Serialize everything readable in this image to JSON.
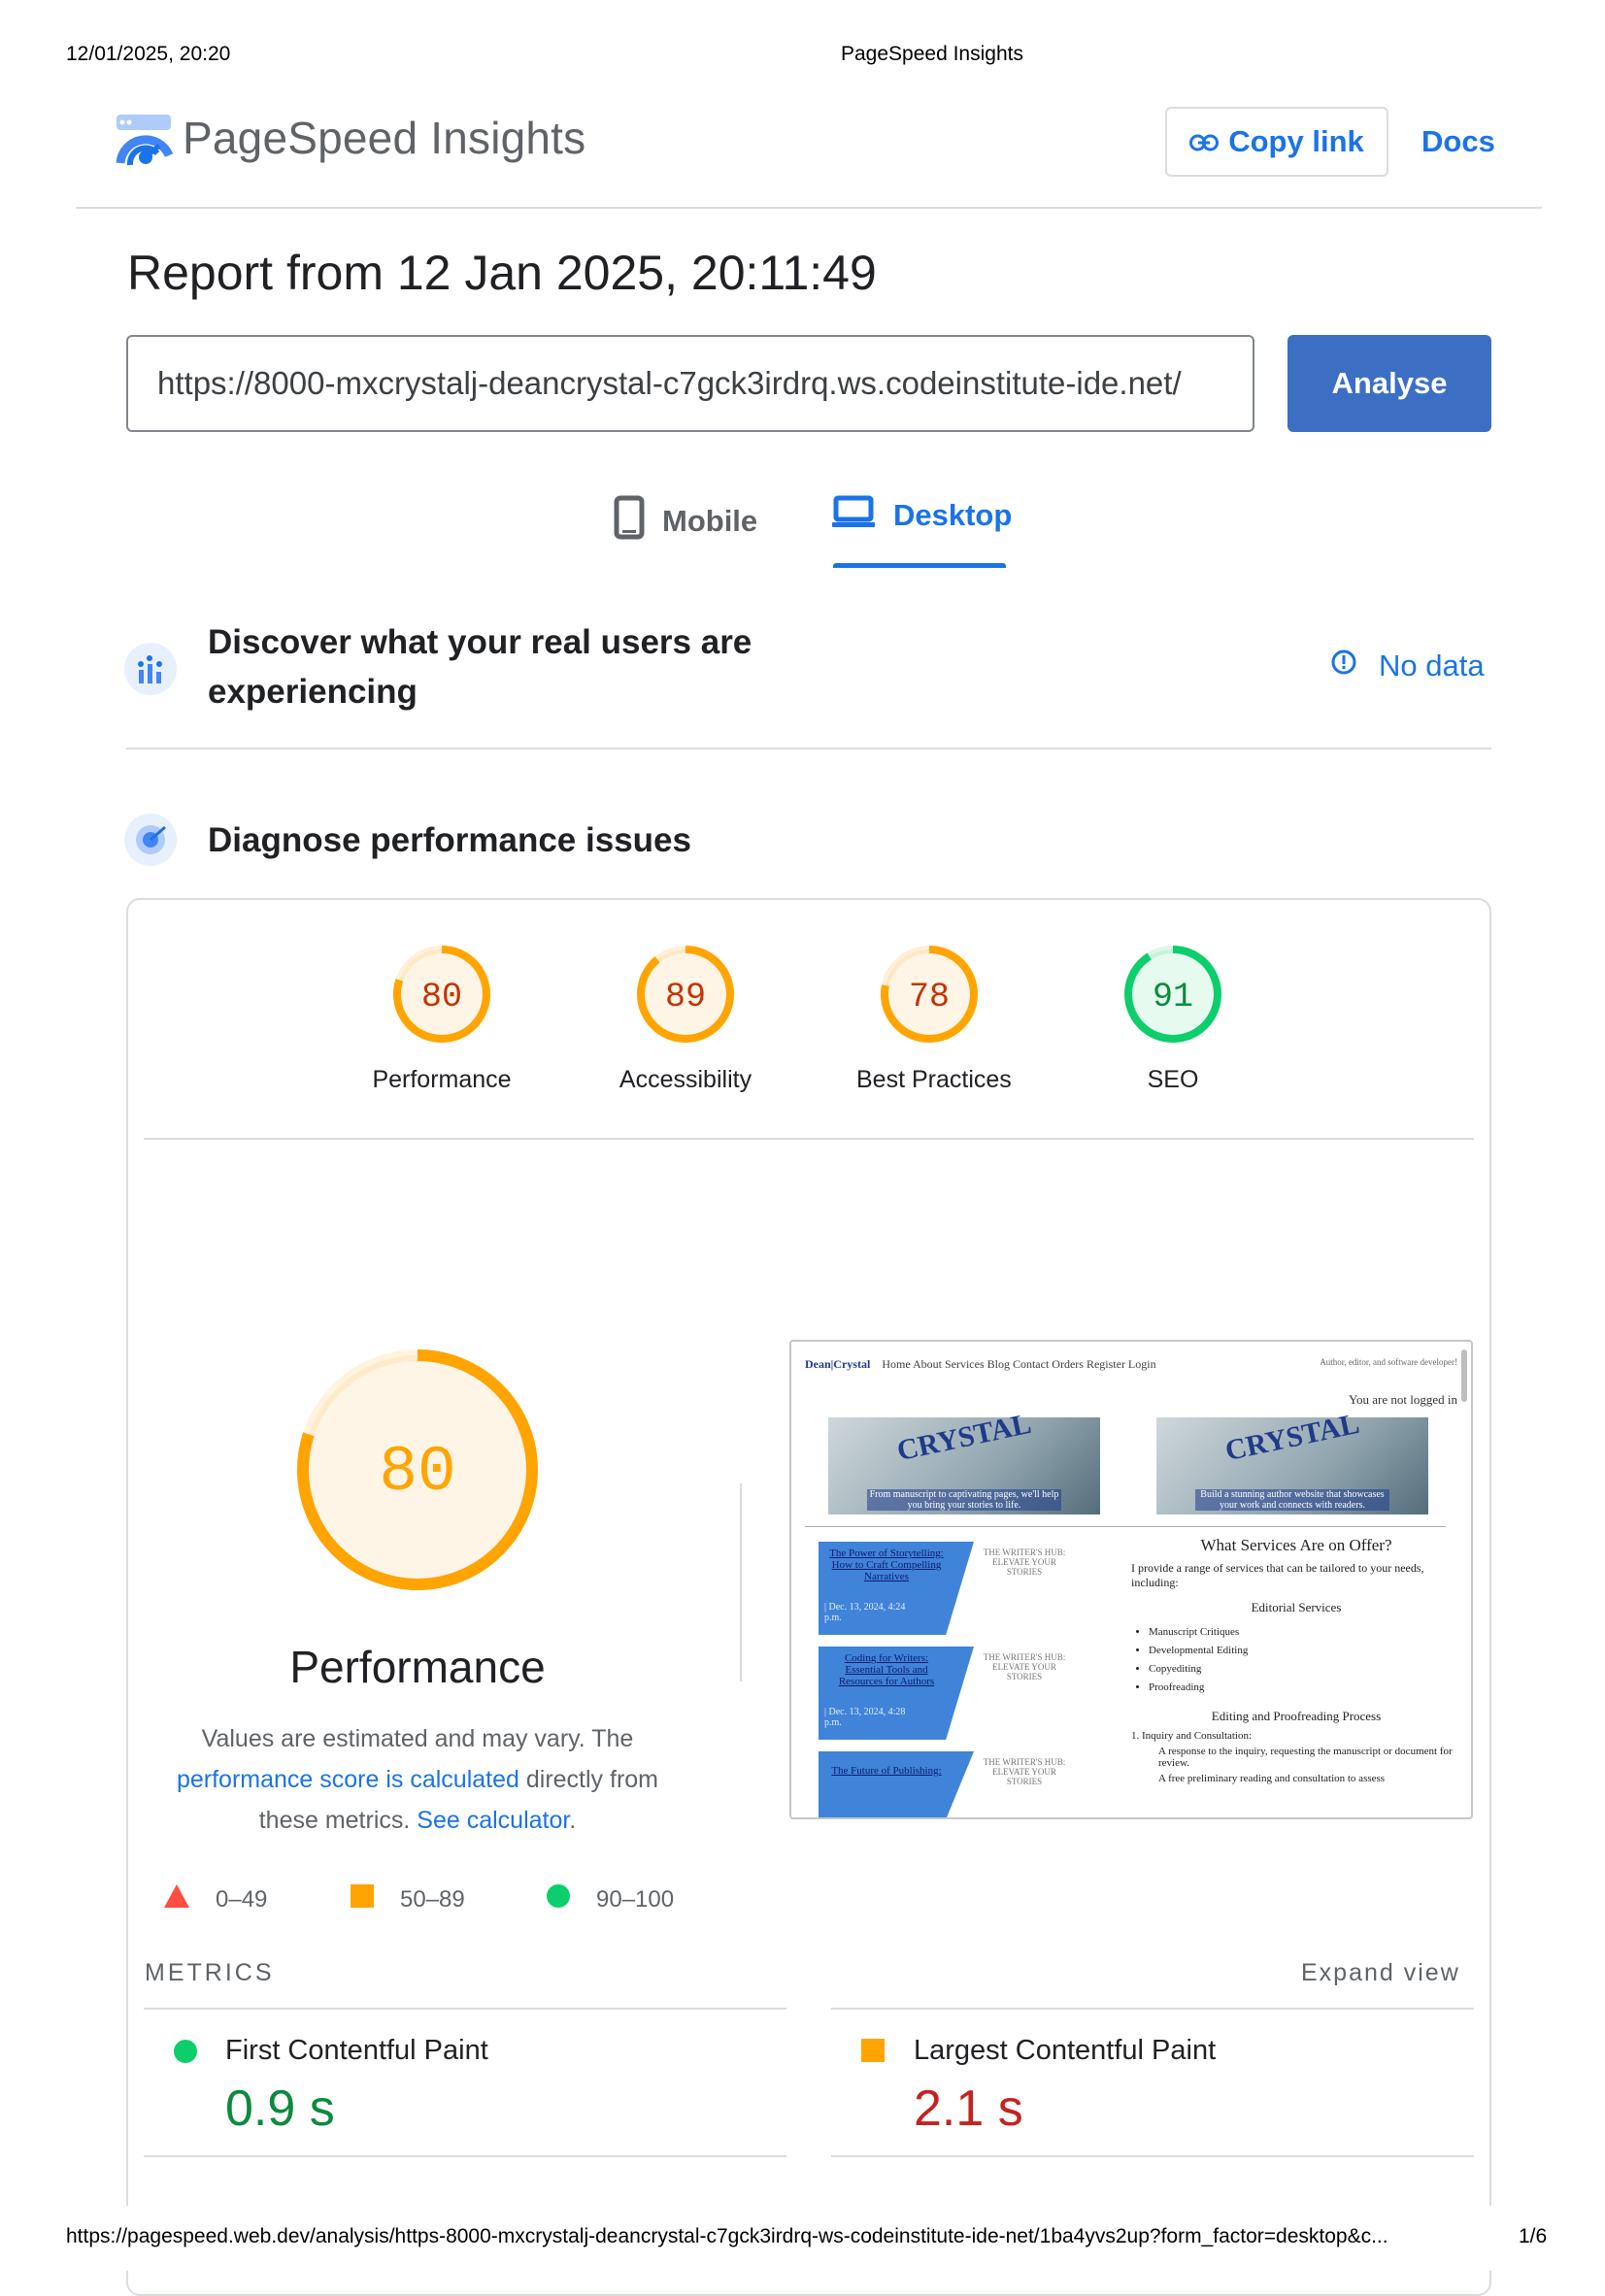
{
  "print_header": {
    "datetime": "12/01/2025, 20:20",
    "title": "PageSpeed Insights"
  },
  "brand": {
    "name": "PageSpeed Insights"
  },
  "header": {
    "copy_link": "Copy link",
    "docs": "Docs"
  },
  "report": {
    "title": "Report from 12 Jan 2025, 20:11:49",
    "url": "https://8000-mxcrystalj-deancrystal-c7gck3irdrq.ws.codeinstitute-ide.net/",
    "analyse": "Analyse"
  },
  "tabs": {
    "mobile": "Mobile",
    "desktop": "Desktop"
  },
  "field_data": {
    "title_line1": "Discover what your real users are",
    "title_line2": "experiencing",
    "status": "No data"
  },
  "diagnose": {
    "title": "Diagnose performance issues"
  },
  "scores": [
    {
      "label": "Performance",
      "value": 80
    },
    {
      "label": "Accessibility",
      "value": 89
    },
    {
      "label": "Best Practices",
      "value": 78
    },
    {
      "label": "SEO",
      "value": 91
    }
  ],
  "performance": {
    "score": 80,
    "title": "Performance",
    "desc_1": "Values are estimated and may vary. The",
    "desc_link_1": "performance score is calculated",
    "desc_2": " directly from",
    "desc_3": "these metrics. ",
    "desc_link_2": "See calculator",
    "desc_4": "."
  },
  "legend": [
    {
      "range": "0–49"
    },
    {
      "range": "50–89"
    },
    {
      "range": "90–100"
    }
  ],
  "metrics": {
    "heading": "METRICS",
    "expand": "Expand view",
    "items": [
      {
        "name": "First Contentful Paint",
        "value": "0.9 s"
      },
      {
        "name": "Largest Contentful Paint",
        "value": "2.1 s"
      }
    ]
  },
  "colors": {
    "pass": "#0cce6b",
    "average": "#ffa400",
    "fail": "#ff4e42",
    "link": "#1a73e8"
  },
  "thumbnail": {
    "nav": "Home  About  Services  Blog  Contact  Orders  Register  Login",
    "logo": "Dean|Crystal",
    "tagline": "Author, editor, and software developer!",
    "logged": "You are not logged in",
    "caption_left": "From manuscript to captivating pages, we'll help you bring your stories to life.",
    "caption_right": "Build a stunning author website that showcases your work and connects with readers.",
    "posts": [
      {
        "title": "The Power of Storytelling: How to Craft Compelling Narratives",
        "date": "| Dec. 13, 2024, 4:24 p.m."
      },
      {
        "title": "Coding for Writers: Essential Tools and Resources for Authors",
        "date": "| Dec. 13, 2024, 4:28 p.m."
      },
      {
        "title": "The Future of Publishing:",
        "date": ""
      }
    ],
    "hub": "THE WRITER'S HUB: ELEVATE YOUR STORIES",
    "services_title": "What Services Are on Offer?",
    "services_intro": "I provide a range of services that can be tailored to your needs, including:",
    "editorial": "Editorial Services",
    "services": [
      "Manuscript Critiques",
      "Developmental Editing",
      "Copyediting",
      "Proofreading"
    ],
    "process": "Editing and Proofreading Process",
    "step1": "1. Inquiry and Consultation:",
    "step1a": "A response to the inquiry, requesting the manuscript or document for review.",
    "step1b": "A free preliminary reading and consultation to assess"
  },
  "footer": {
    "url": "https://pagespeed.web.dev/analysis/https-8000-mxcrystalj-deancrystal-c7gck3irdrq-ws-codeinstitute-ide-net/1ba4yvs2up?form_factor=desktop&c...",
    "page": "1/6"
  }
}
